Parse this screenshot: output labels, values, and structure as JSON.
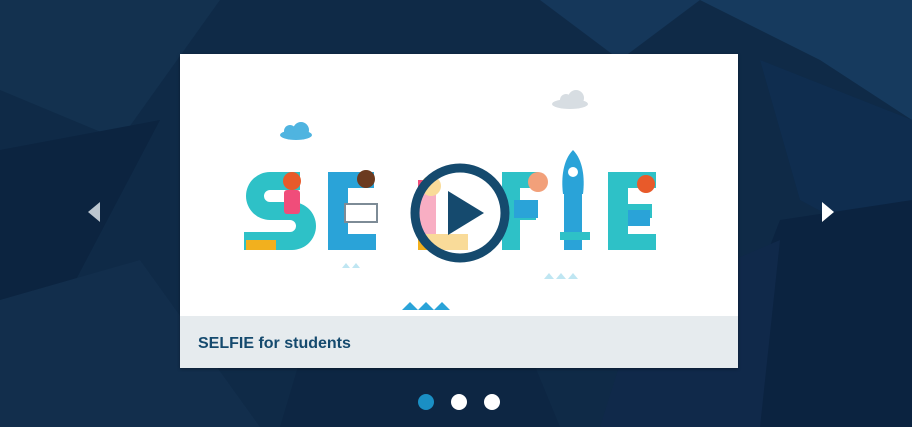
{
  "carousel": {
    "slides": [
      {
        "title": "SELFIE for students"
      }
    ],
    "active_index": 0,
    "slide_count": 3
  },
  "slide": {
    "caption": "SELFIE for students",
    "icons": {
      "play": "play-icon",
      "prev": "chevron-left-icon",
      "next": "chevron-right-icon"
    }
  },
  "colors": {
    "background": "#0f2a47",
    "accent": "#1a8fc4",
    "caption_text": "#154a6e",
    "caption_bar": "#e6ebee"
  }
}
